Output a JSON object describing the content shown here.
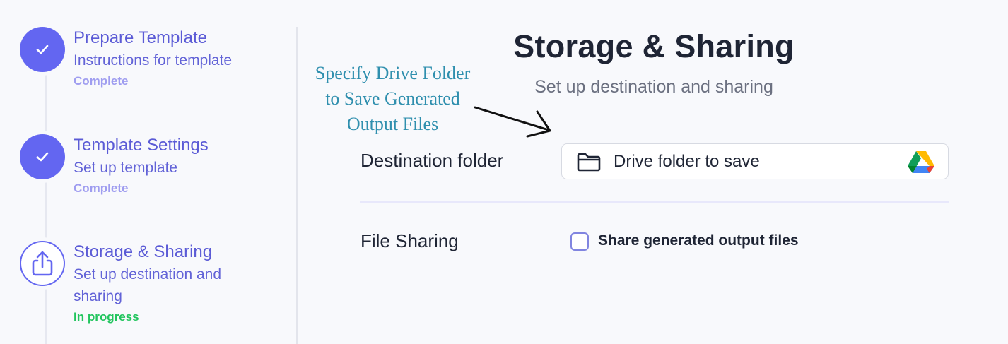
{
  "steps": [
    {
      "title": "Prepare Template",
      "description": "Instructions for template",
      "status": "Complete",
      "icon": "check-icon"
    },
    {
      "title": "Template Settings",
      "description": "Set up template",
      "status": "Complete",
      "icon": "check-icon"
    },
    {
      "title": "Storage & Sharing",
      "description": "Set up destination and sharing",
      "status": "In progress",
      "icon": "share-upload-icon"
    }
  ],
  "header": {
    "title": "Storage & Sharing",
    "subtitle": "Set up destination and sharing"
  },
  "annotation": {
    "line1": "Specify Drive Folder",
    "line2": "to Save Generated",
    "line3": "Output Files"
  },
  "form": {
    "destination_label": "Destination folder",
    "destination_value": "Drive folder to save",
    "sharing_label": "File Sharing",
    "sharing_checkbox_label": "Share generated output files",
    "sharing_checked": false
  },
  "colors": {
    "accent": "#6366f1",
    "complete_status": "#9f9df0",
    "in_progress_status": "#22c55e",
    "annotation": "#2f8fae"
  }
}
